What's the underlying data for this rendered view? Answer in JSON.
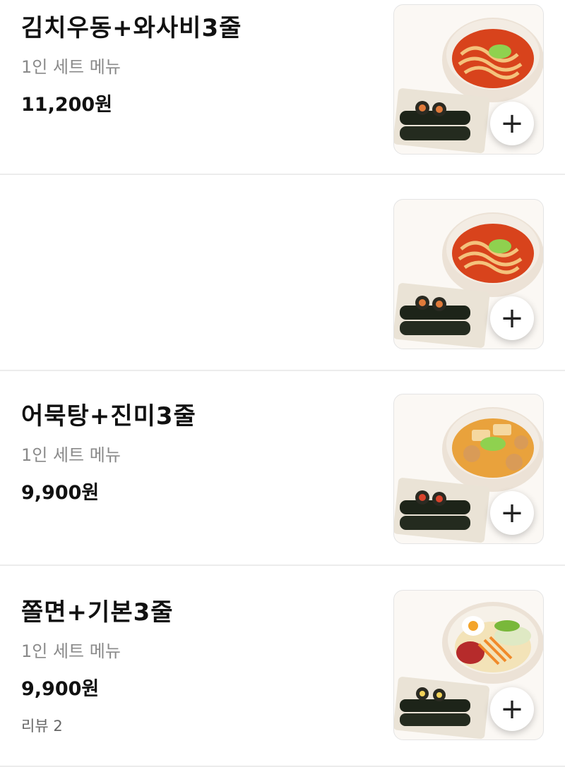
{
  "menu_items": [
    {
      "name": "김치우동+와사비3줄",
      "description": "1인 세트 메뉴",
      "price": "11,200원",
      "review": "",
      "image": "kimchi-udon-and-gimbap-photo",
      "add_icon": "+"
    },
    {
      "name": "",
      "description": "",
      "price": "",
      "review": "",
      "image": "kimchi-udon-and-gimbap-photo",
      "add_icon": "+"
    },
    {
      "name": "어묵탕+진미3줄",
      "description": "1인 세트 메뉴",
      "price": "9,900원",
      "review": "",
      "image": "fishcake-soup-and-gimbap-photo",
      "add_icon": "+"
    },
    {
      "name": "쫄면+기본3줄",
      "description": "1인 세트 메뉴",
      "price": "9,900원",
      "review": "리뷰 2",
      "image": "jjolmyeon-and-gimbap-photo",
      "add_icon": "+"
    }
  ],
  "colors": {
    "divider": "#ececec",
    "title": "#111111",
    "subtitle": "#8a8a8a",
    "soup_red": "#d8431c",
    "broth_orange": "#e9a23c"
  }
}
